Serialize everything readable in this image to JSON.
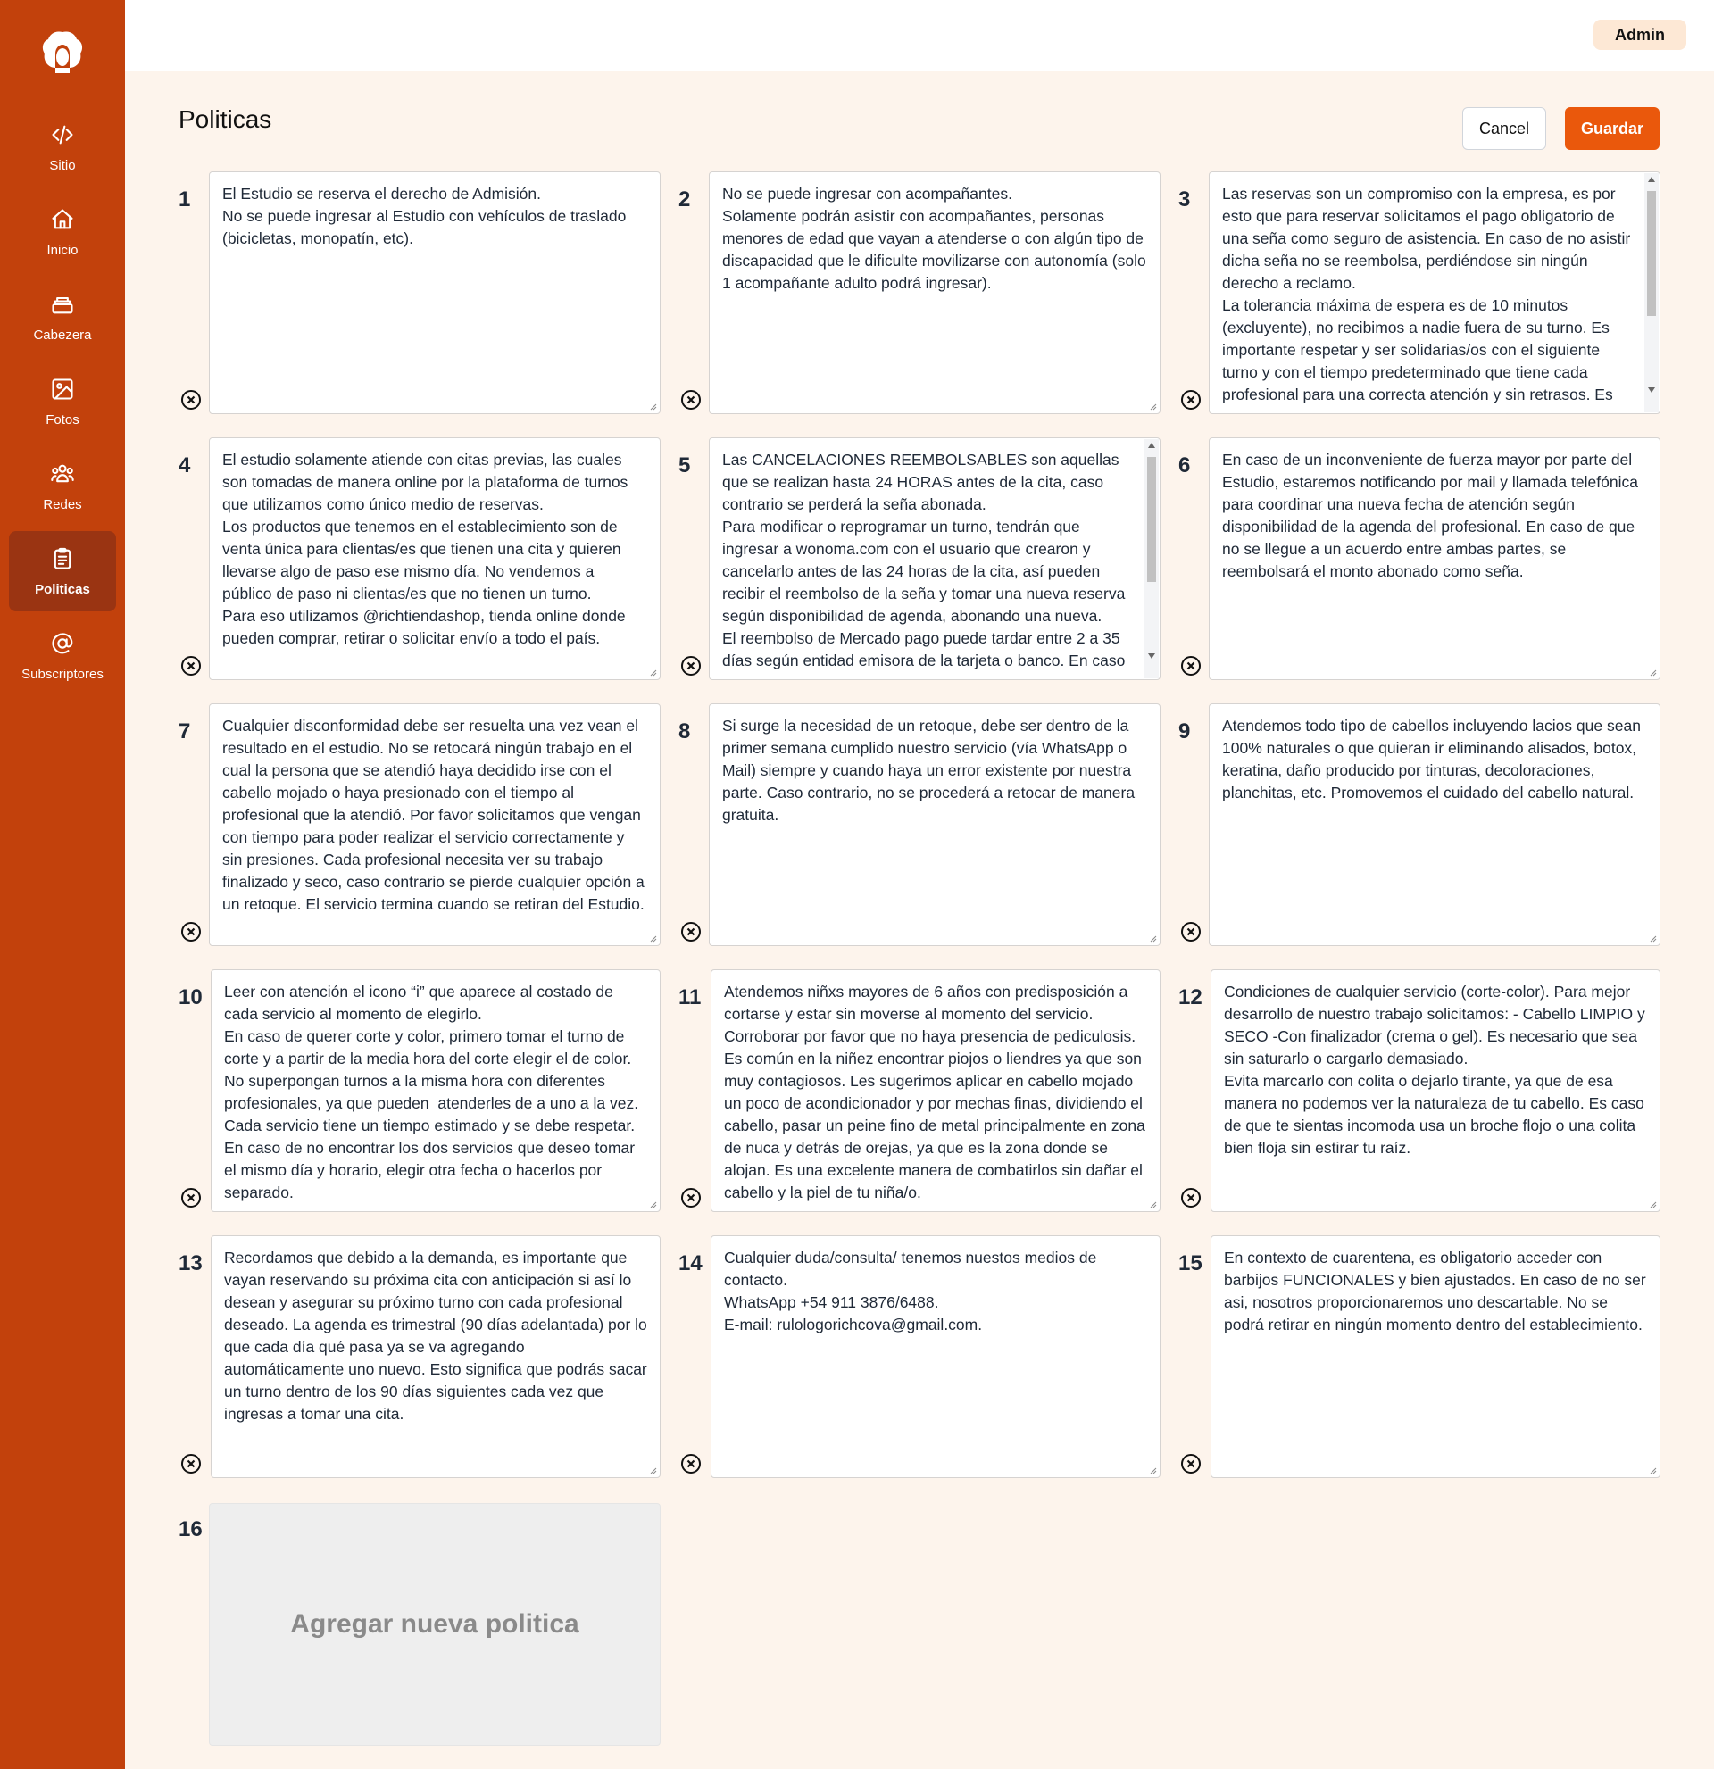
{
  "sidebar": {
    "items": [
      {
        "label": "Sitio",
        "icon": "code-icon"
      },
      {
        "label": "Inicio",
        "icon": "home-icon"
      },
      {
        "label": "Cabezera",
        "icon": "stack-icon"
      },
      {
        "label": "Fotos",
        "icon": "image-icon"
      },
      {
        "label": "Redes",
        "icon": "users-icon"
      },
      {
        "label": "Politicas",
        "icon": "clipboard-icon",
        "active": true
      },
      {
        "label": "Subscriptores",
        "icon": "at-icon"
      }
    ]
  },
  "header": {
    "user_label": "Admin"
  },
  "page": {
    "title": "Politicas",
    "cancel_label": "Cancel",
    "save_label": "Guardar",
    "add_label": "Agregar nueva politica",
    "add_number": "16"
  },
  "policies": [
    {
      "number": "1",
      "text": "El Estudio se reserva el derecho de Admisión.\nNo se puede ingresar al Estudio con vehículos de traslado (bicicletas, monopatín, etc)."
    },
    {
      "number": "2",
      "text": "No se puede ingresar con acompañantes.\nSolamente podrán asistir con acompañantes, personas menores de edad que vayan a atenderse o con algún tipo de discapacidad que le dificulte movilizarse con autonomía (solo 1 acompañante adulto podrá ingresar)."
    },
    {
      "number": "3",
      "text": "Las reservas son un compromiso con la empresa, es por esto que para reservar solicitamos el pago obligatorio de una seña como seguro de asistencia. En caso de no asistir dicha seña no se reembolsa, perdiéndose sin ningún derecho a reclamo.\nLa tolerancia máxima de espera es de 10 minutos (excluyente), no recibimos a nadie fuera de su turno. Es importante respetar y ser solidarias/os con el siguiente turno y con el tiempo predeterminado que tiene cada profesional para una correcta atención y sin retrasos. Es"
    },
    {
      "number": "4",
      "text": "El estudio solamente atiende con citas previas, las cuales son tomadas de manera online por la plataforma de turnos que utilizamos como único medio de reservas.\nLos productos que tenemos en el establecimiento son de venta única para clientas/es que tienen una cita y quieren llevarse algo de paso ese mismo día. No vendemos a público de paso ni clientas/es que no tienen un turno.\nPara eso utilizamos @richtiendashop, tienda online donde pueden comprar, retirar o solicitar envío a todo el país."
    },
    {
      "number": "5",
      "text": "Las CANCELACIONES REEMBOLSABLES son aquellas que se realizan hasta 24 HORAS antes de la cita, caso contrario se perderá la seña abonada.\nPara modificar o reprogramar un turno, tendrán que ingresar a wonoma.com con el usuario que crearon y cancelarlo antes de las 24 horas de la cita, así pueden recibir el reembolso de la seña y tomar una nueva reserva según disponibilidad de agenda, abonando una nueva.\nEl reembolso de Mercado pago puede tardar entre 2 a 35 días según entidad emisora de la tarjeta o banco. En caso"
    },
    {
      "number": "6",
      "text": "En caso de un inconveniente de fuerza mayor por parte del Estudio, estaremos notificando por mail y llamada telefónica para coordinar una nueva fecha de atención según disponibilidad de la agenda del profesional. En caso de que no se llegue a un acuerdo entre ambas partes, se reembolsará el monto abonado como seña."
    },
    {
      "number": "7",
      "text": "Cualquier disconformidad debe ser resuelta una vez vean el resultado en el estudio. No se retocará ningún trabajo en el cual la persona que se atendió haya decidido irse con el cabello mojado o haya presionado con el tiempo al profesional que la atendió. Por favor solicitamos que vengan con tiempo para poder realizar el servicio correctamente y sin presiones. Cada profesional necesita ver su trabajo finalizado y seco, caso contrario se pierde cualquier opción a un retoque. El servicio termina cuando se retiran del Estudio."
    },
    {
      "number": "8",
      "text": "Si surge la necesidad de un retoque, debe ser dentro de la primer semana cumplido nuestro servicio (vía WhatsApp o Mail) siempre y cuando haya un error existente por nuestra parte. Caso contrario, no se procederá a retocar de manera gratuita."
    },
    {
      "number": "9",
      "text": "Atendemos todo tipo de cabellos incluyendo lacios que sean 100% naturales o que quieran ir eliminando alisados, botox, keratina, daño producido por tinturas, decoloraciones, planchitas, etc. Promovemos el cuidado del cabello natural."
    },
    {
      "number": "10",
      "text": "Leer con atención el icono “i” que aparece al costado de cada servicio al momento de elegirlo.\nEn caso de querer corte y color, primero tomar el turno de corte y a partir de la media hora del corte elegir el de color.\nNo superpongan turnos a la misma hora con diferentes profesionales, ya que pueden  atenderles de a uno a la vez.\nCada servicio tiene un tiempo estimado y se debe respetar.\nEn caso de no encontrar los dos servicios que deseo tomar el mismo día y horario, elegir otra fecha o hacerlos por separado."
    },
    {
      "number": "11",
      "text": "Atendemos niñxs mayores de 6 años con predisposición a cortarse y estar sin moverse al momento del servicio.\nCorroborar por favor que no haya presencia de pediculosis. Es común en la niñez encontrar piojos o liendres ya que son muy contagiosos. Les sugerimos aplicar en cabello mojado un poco de acondicionador y por mechas finas, dividiendo el cabello, pasar un peine fino de metal principalmente en zona de nuca y detrás de orejas, ya que es la zona donde se alojan. Es una excelente manera de combatirlos sin dañar el cabello y la piel de tu niña/o."
    },
    {
      "number": "12",
      "text": "Condiciones de cualquier servicio (corte-color). Para mejor desarrollo de nuestro trabajo solicitamos: - Cabello LIMPIO y SECO -Con finalizador (crema o gel). Es necesario que sea sin saturarlo o cargarlo demasiado.\nEvita marcarlo con colita o dejarlo tirante, ya que de esa manera no podemos ver la naturaleza de tu cabello. Es caso de que te sientas incomoda usa un broche flojo o una colita bien floja sin estirar tu raíz."
    },
    {
      "number": "13",
      "text": "Recordamos que debido a la demanda, es importante que vayan reservando su próxima cita con anticipación si así lo desean y asegurar su próximo turno con cada profesional deseado. La agenda es trimestral (90 días adelantada) por lo que cada día qué pasa ya se va agregando automáticamente uno nuevo. Esto significa que podrás sacar un turno dentro de los 90 días siguientes cada vez que ingresas a tomar una cita."
    },
    {
      "number": "14",
      "text": "Cualquier duda/consulta/ tenemos nuestos medios de contacto.\nWhatsApp +54 911 3876/6488.\nE-mail: rulologorichcova@gmail.com."
    },
    {
      "number": "15",
      "text": "En contexto de cuarentena, es obligatorio acceder con barbijos FUNCIONALES y bien ajustados. En caso de no ser asi, nosotros proporcionaremos uno descartable. No se podrá retirar en ningún momento dentro del establecimiento."
    }
  ],
  "colors": {
    "sidebar": "#c2410c",
    "sidebar_active": "#9a3412",
    "accent": "#ea580c",
    "background": "#fdf4ec"
  }
}
